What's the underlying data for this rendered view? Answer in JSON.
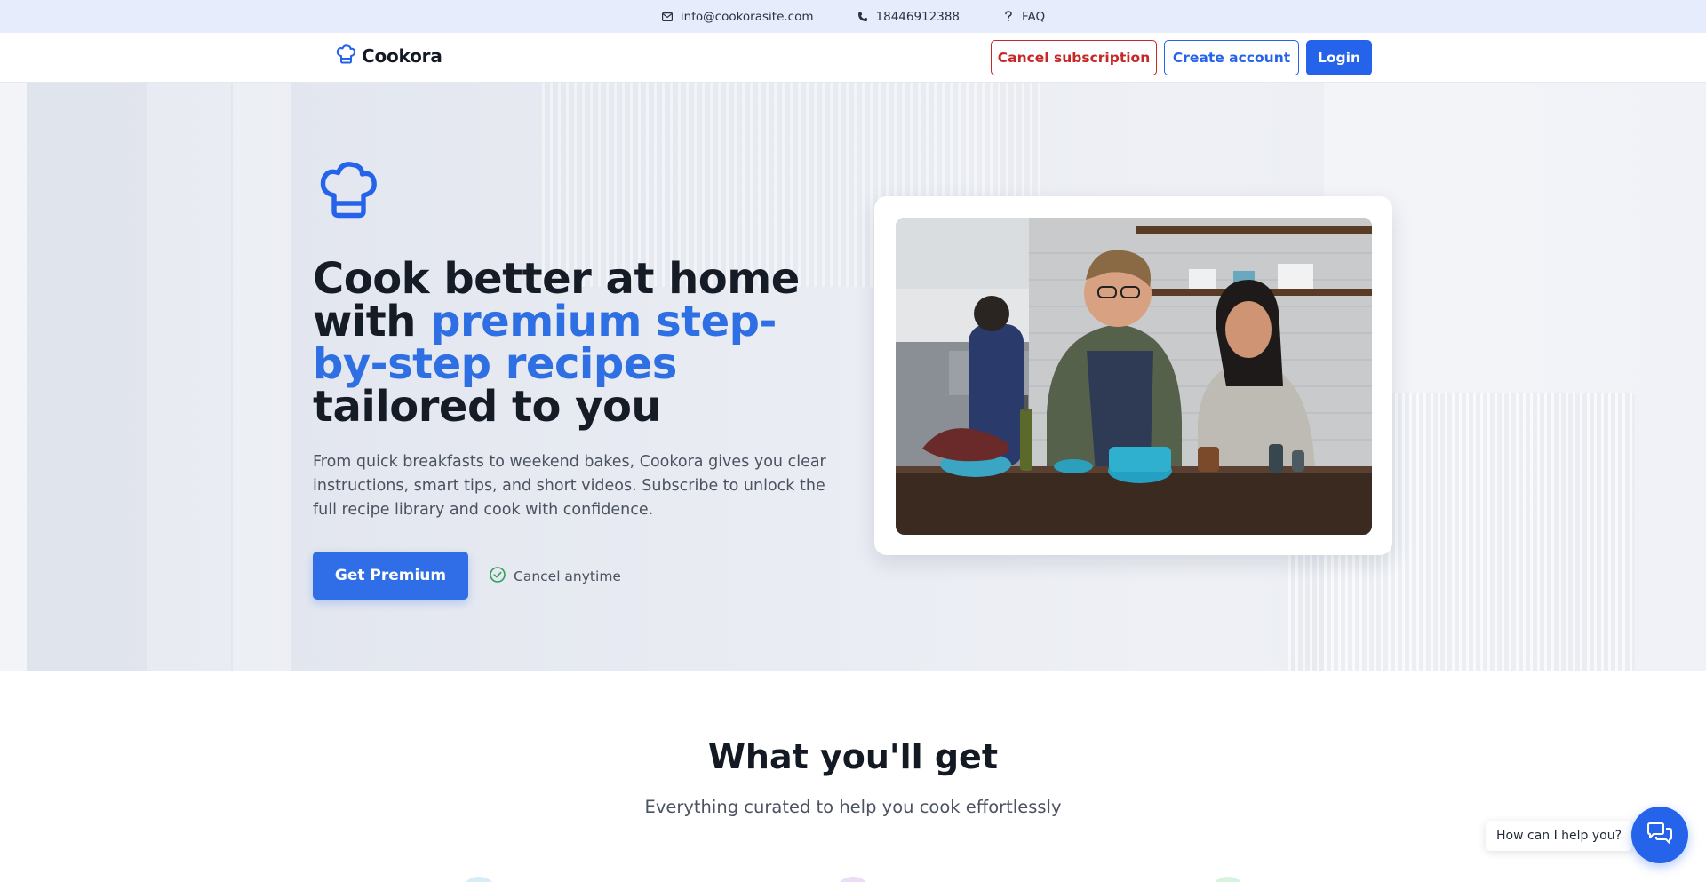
{
  "topbar": {
    "email": "info@cookorasite.com",
    "phone": "18446912388",
    "faq": "FAQ"
  },
  "header": {
    "brand": "Cookora",
    "cancel_subscription": "Cancel subscription",
    "create_account": "Create account",
    "login": "Login"
  },
  "hero": {
    "headline_part1": "Cook better at home with ",
    "headline_accent": "premium step-by-step recipes",
    "headline_part2": " tailored to you",
    "lead": "From quick breakfasts to weekend bakes, Cookora gives you clear instructions, smart tips, and short videos. Subscribe to unlock the full recipe library and cook with confidence.",
    "cta": "Get Premium",
    "cancel_note": "Cancel anytime"
  },
  "features": {
    "title": "What you'll get",
    "subtitle": "Everything curated to help you cook effortlessly"
  },
  "chat": {
    "prompt": "How can I help you?"
  },
  "colors": {
    "accent": "#2563eb",
    "danger": "#c62828",
    "topbar_bg": "#e6ecfb"
  },
  "icons": {
    "email": "mail-icon",
    "phone": "phone-icon",
    "faq": "question-icon",
    "logo": "chef-hat-icon",
    "cancel_note": "check-circle-icon",
    "chat": "chat-icon"
  }
}
